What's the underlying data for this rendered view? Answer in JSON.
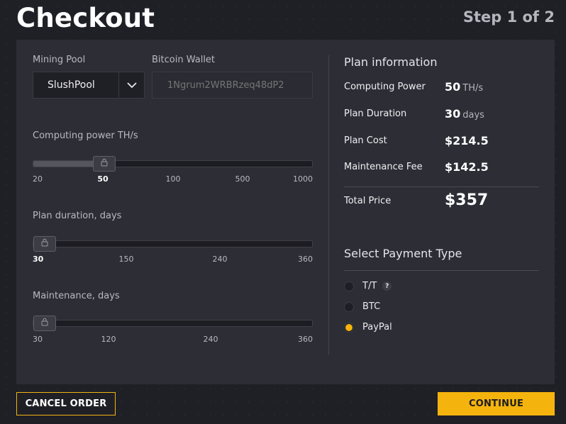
{
  "header": {
    "title": "Checkout",
    "step": "Step 1 of 2"
  },
  "form": {
    "mining_pool": {
      "label": "Mining Pool",
      "selected": "SlushPool"
    },
    "wallet": {
      "label": "Bitcoin Wallet",
      "placeholder": "1Ngrum2WRBRzeq48dP2"
    },
    "computing_power": {
      "label": "Computing power TH/s",
      "ticks": [
        "20",
        "50",
        "100",
        "500",
        "1000"
      ],
      "selected": "50",
      "fraction": 0.25
    },
    "plan_duration": {
      "label": "Plan duration, days",
      "ticks": [
        "30",
        "150",
        "240",
        "360"
      ],
      "selected": "30",
      "fraction": 0
    },
    "maintenance": {
      "label": "Maintenance, days",
      "ticks": [
        "30",
        "120",
        "240",
        "360"
      ],
      "selected": "30",
      "fraction": 0
    }
  },
  "plan": {
    "title": "Plan information",
    "computing_power_label": "Computing Power",
    "computing_power_value": "50",
    "computing_power_unit": "TH/s",
    "duration_label": "Plan Duration",
    "duration_value": "30",
    "duration_unit": "days",
    "cost_label": "Plan Cost",
    "cost_value": "$214.5",
    "fee_label": "Maintenance Fee",
    "fee_value": "$142.5",
    "total_label": "Total Price",
    "total_value": "$357"
  },
  "payment": {
    "title": "Select Payment Type",
    "options": [
      {
        "label": "T/T",
        "checked": false,
        "help": "?"
      },
      {
        "label": "BTC",
        "checked": false
      },
      {
        "label": "PayPal",
        "checked": true
      }
    ]
  },
  "actions": {
    "cancel_label": "CANCEL ORDER",
    "continue_label": "CONTINUE"
  },
  "colors": {
    "accent": "#f5b40d",
    "background": "#1f1f26",
    "panel": "#2d2d36"
  }
}
